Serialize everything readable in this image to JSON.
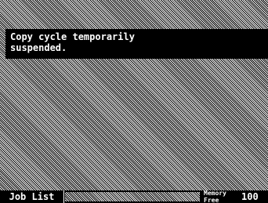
{
  "message": {
    "line1": "Copy cycle temporarily",
    "line2": "suspended."
  },
  "bottom_bar": {
    "job_list_label": "Job List",
    "memory_label": "Memory Free",
    "memory_value": "100"
  },
  "colors": {
    "foreground": "#000000",
    "background": "#ffffff"
  }
}
